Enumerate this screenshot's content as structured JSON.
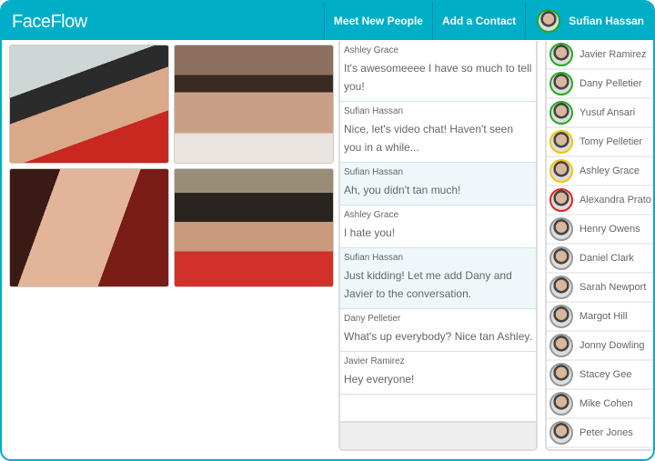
{
  "header": {
    "logo": "FaceFlow",
    "nav": [
      "Meet New People",
      "Add a Contact"
    ],
    "user": "Sufian Hassan"
  },
  "colors": {
    "brand": "#00aec7",
    "online": "#22aa22",
    "away": "#f5c400",
    "busy": "#e52222",
    "offline": "#999999"
  },
  "messages": [
    {
      "author": "Ashley Grace",
      "text": "It's awesomeeee I have so much to tell you!",
      "highlight": false
    },
    {
      "author": "Sufian Hassan",
      "text": "Nice, let's video chat! Haven't seen you in a while...",
      "highlight": false
    },
    {
      "author": "Sufian Hassan",
      "text": "Ah, you didn't tan much!",
      "highlight": true
    },
    {
      "author": "Ashley Grace",
      "text": "I hate you!",
      "highlight": false
    },
    {
      "author": "Sufian Hassan",
      "text": "Just kidding! Let me add Dany and Javier to the conversation.",
      "highlight": true
    },
    {
      "author": "Dany Pelletier",
      "text": "What's up everybody? Nice tan Ashley.",
      "highlight": false
    },
    {
      "author": "Javier Ramirez",
      "text": "Hey everyone!",
      "highlight": false
    }
  ],
  "contacts": [
    {
      "name": "Javier Ramirez",
      "status": "online"
    },
    {
      "name": "Dany Pelletier",
      "status": "online"
    },
    {
      "name": "Yusuf Ansari",
      "status": "online"
    },
    {
      "name": "Tomy Pelletier",
      "status": "away"
    },
    {
      "name": "Ashley Grace",
      "status": "away"
    },
    {
      "name": "Alexandra Prato",
      "status": "busy"
    },
    {
      "name": "Henry Owens",
      "status": "offline"
    },
    {
      "name": "Daniel Clark",
      "status": "offline"
    },
    {
      "name": "Sarah Newport",
      "status": "offline"
    },
    {
      "name": "Margot Hill",
      "status": "offline"
    },
    {
      "name": "Jonny Dowling",
      "status": "offline"
    },
    {
      "name": "Stacey Gee",
      "status": "offline"
    },
    {
      "name": "Mike Cohen",
      "status": "offline"
    },
    {
      "name": "Peter Jones",
      "status": "offline"
    }
  ]
}
